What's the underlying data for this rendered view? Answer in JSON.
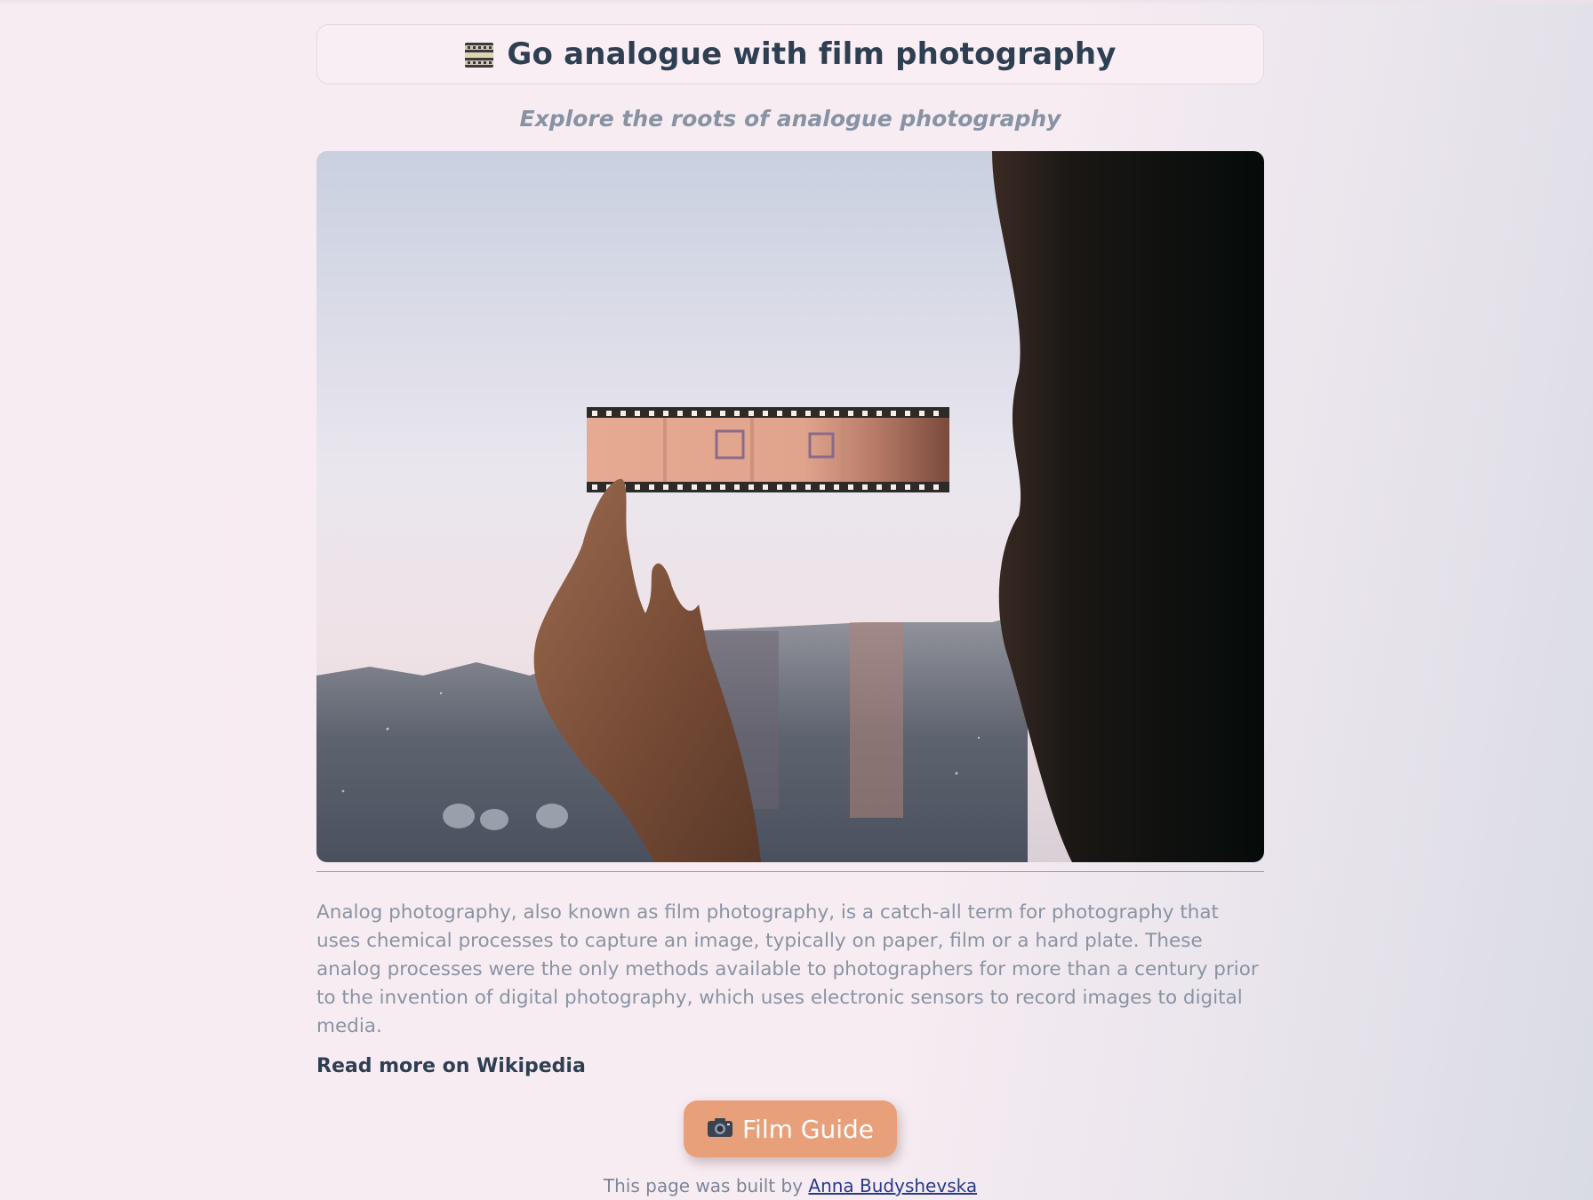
{
  "header": {
    "title": "Go analogue with film photography",
    "icon": "film-frames-icon"
  },
  "subtitle": "Explore the roots of analogue photography",
  "hero_image": {
    "description_icon": "film-strip-photo"
  },
  "article": {
    "body": "Analog photography, also known as film photography, is a catch-all term for photography that uses chemical processes to capture an image, typically on paper, film or a hard plate. These analog processes were the only methods available to photographers for more than a century prior to the invention of digital photography, which uses electronic sensors to record images to digital media.",
    "read_more_label": "Read more on Wikipedia"
  },
  "cta": {
    "label": "Film Guide",
    "icon": "camera-icon",
    "color": "#e8a07a"
  },
  "footer": {
    "prefix": "This page was built by ",
    "author": "Anna Budyshevska"
  },
  "colors": {
    "heading": "#2f3f52",
    "muted": "#8a93a2",
    "link": "#283a8a"
  }
}
